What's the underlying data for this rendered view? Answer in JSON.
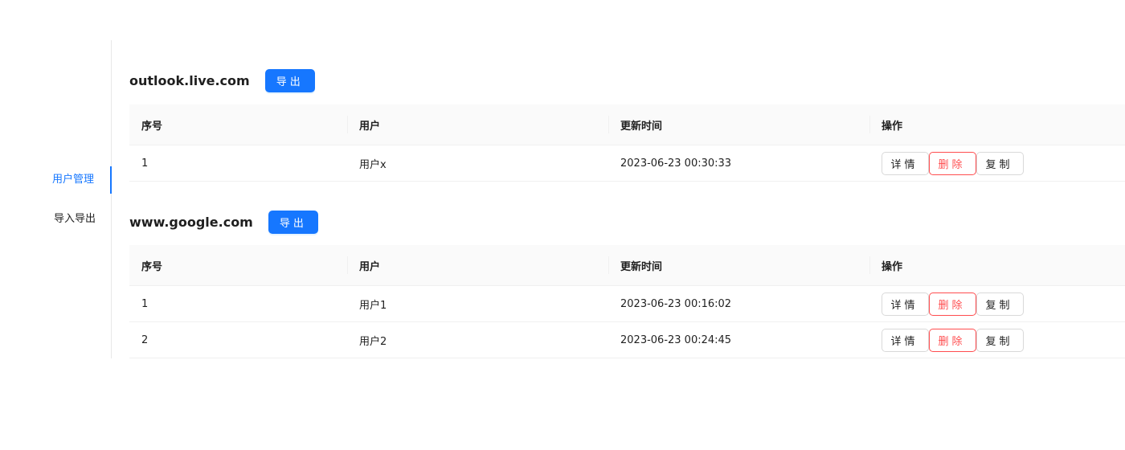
{
  "sidebar": {
    "items": [
      {
        "label": "用户管理",
        "active": true
      },
      {
        "label": "导入导出",
        "active": false
      }
    ]
  },
  "colors": {
    "primary": "#1677ff",
    "danger": "#ff4d4f",
    "header_bg": "#fafafa",
    "border": "#f0f0f0"
  },
  "sections": [
    {
      "domain": "outlook.live.com",
      "export_label": "导出",
      "columns": [
        "序号",
        "用户",
        "更新时间",
        "操作"
      ],
      "rows": [
        {
          "index": "1",
          "user": "用户x",
          "updated": "2023-06-23 00:30:33"
        }
      ]
    },
    {
      "domain": "www.google.com",
      "export_label": "导出",
      "columns": [
        "序号",
        "用户",
        "更新时间",
        "操作"
      ],
      "rows": [
        {
          "index": "1",
          "user": "用户1",
          "updated": "2023-06-23 00:16:02"
        },
        {
          "index": "2",
          "user": "用户2",
          "updated": "2023-06-23 00:24:45"
        }
      ]
    }
  ],
  "row_actions": {
    "detail": "详情",
    "delete": "删除",
    "copy": "复制"
  }
}
